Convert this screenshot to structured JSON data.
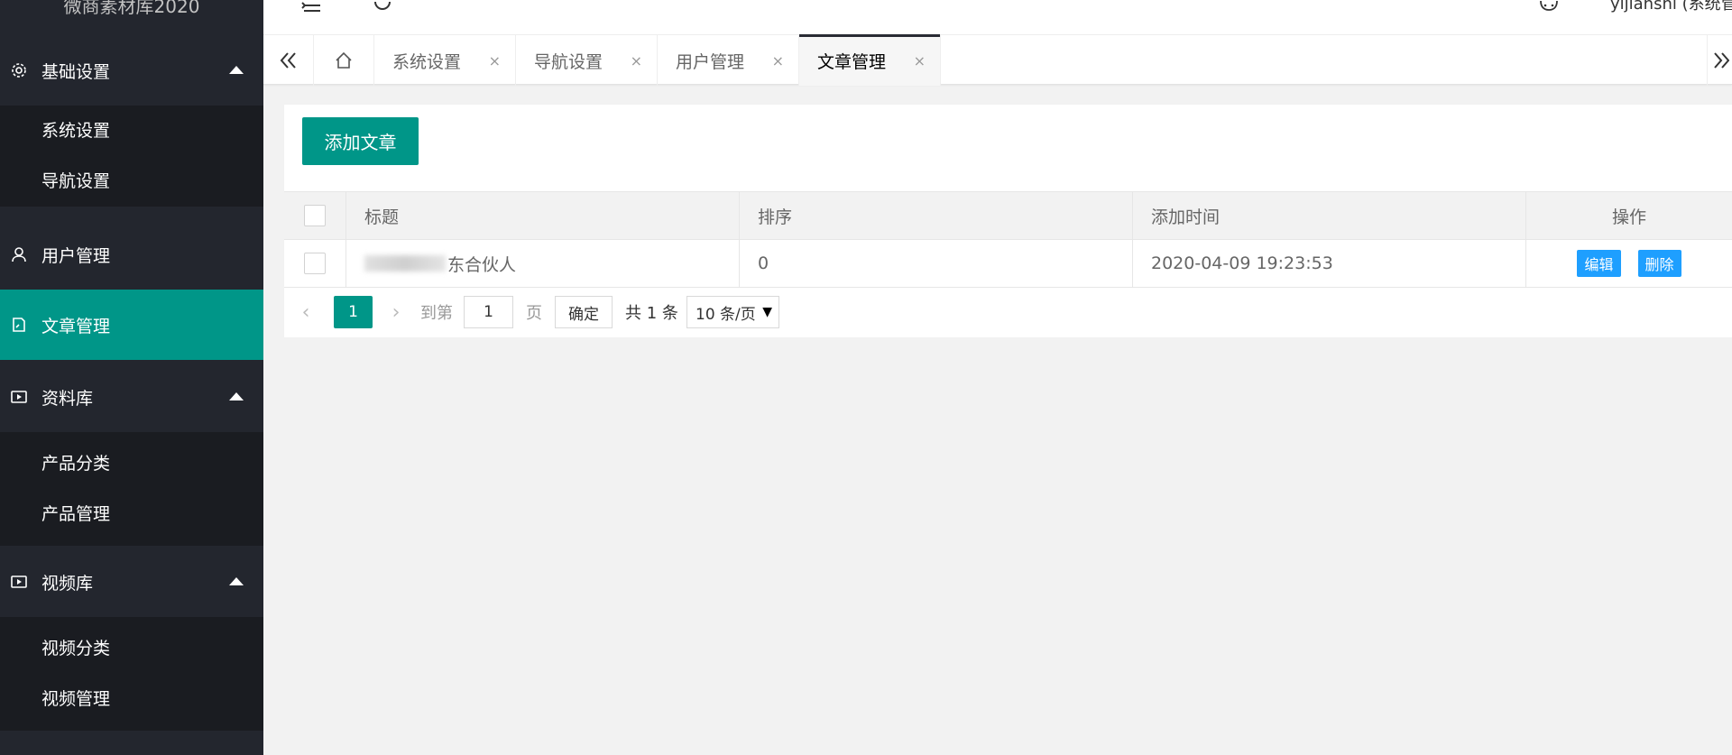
{
  "app": {
    "logo_text": "微商素材库2020"
  },
  "sidebar": {
    "groups": [
      {
        "label": "基础设置",
        "icon": "gear-icon"
      },
      {
        "label": "用户管理",
        "icon": "user-icon"
      },
      {
        "label": "文章管理",
        "icon": "document-icon"
      },
      {
        "label": "资料库",
        "icon": "play-icon"
      },
      {
        "label": "视频库",
        "icon": "play-icon"
      }
    ],
    "sub_basic": [
      "系统设置",
      "导航设置"
    ],
    "sub_library": [
      "产品分类",
      "产品管理"
    ],
    "sub_video": [
      "视频分类",
      "视频管理"
    ],
    "active": "文章管理"
  },
  "header": {
    "user": "yijianshi (系统管"
  },
  "tabs": [
    {
      "label": "系统设置"
    },
    {
      "label": "导航设置"
    },
    {
      "label": "用户管理"
    },
    {
      "label": "文章管理",
      "active": true
    }
  ],
  "tab_close": "×",
  "content": {
    "add_button": "添加文章",
    "table": {
      "headers": [
        "标题",
        "排序",
        "添加时间",
        "操作"
      ],
      "rows": [
        {
          "title_visible": "东合伙人",
          "sort": "0",
          "time": "2020-04-09 19:23:53",
          "edit": "编辑",
          "delete": "删除"
        }
      ]
    },
    "pager": {
      "prev": "‹",
      "next": "›",
      "current": "1",
      "goto_label": "到第",
      "goto_value": "1",
      "page_unit": "页",
      "confirm": "确定",
      "total": "共 1 条",
      "page_size": "10 条/页"
    }
  },
  "colors": {
    "sidebar_bg": "#23262e",
    "submenu_bg": "#1a1c21",
    "accent": "#009688",
    "op_blue": "#1e9fff"
  }
}
